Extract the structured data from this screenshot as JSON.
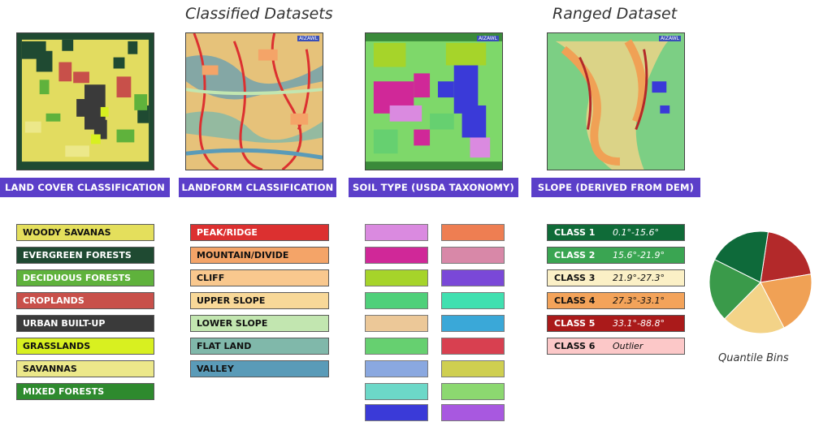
{
  "headings": {
    "classified": "Classified Datasets",
    "ranged": "Ranged Dataset"
  },
  "maps": [
    {
      "label": "LAND COVER CLASSIFICATION",
      "badge": ""
    },
    {
      "label": "LANDFORM CLASSIFICATION",
      "badge": "AIZAWL"
    },
    {
      "label": "SOIL TYPE (USDA TAXONOMY)",
      "badge": "AIZAWL"
    },
    {
      "label": "SLOPE (DERIVED FROM DEM)",
      "badge": "AIZAWL"
    }
  ],
  "land_cover_legend": [
    {
      "label": "WOODY SAVANAS",
      "color": "#e4df5c",
      "text_color": "#111111"
    },
    {
      "label": "EVERGREEN FORESTS",
      "color": "#1f4a32",
      "text_color": "#ffffff"
    },
    {
      "label": "DECIDUOUS FORESTS",
      "color": "#5fb23c",
      "text_color": "#ffffff"
    },
    {
      "label": "CROPLANDS",
      "color": "#c8504a",
      "text_color": "#ffffff"
    },
    {
      "label": "URBAN BUILT-UP",
      "color": "#3a3a3a",
      "text_color": "#ffffff"
    },
    {
      "label": "GRASSLANDS",
      "color": "#d8f020",
      "text_color": "#111111"
    },
    {
      "label": "SAVANNAS",
      "color": "#ece88a",
      "text_color": "#111111"
    },
    {
      "label": "MIXED FORESTS",
      "color": "#2e8a2e",
      "text_color": "#ffffff"
    }
  ],
  "landform_legend": [
    {
      "label": "PEAK/RIDGE",
      "color": "#dc3030",
      "text_color": "#ffffff"
    },
    {
      "label": "MOUNTAIN/DIVIDE",
      "color": "#f4a468",
      "text_color": "#111111"
    },
    {
      "label": "CLIFF",
      "color": "#f9c88e",
      "text_color": "#111111"
    },
    {
      "label": "UPPER SLOPE",
      "color": "#f8d898",
      "text_color": "#111111"
    },
    {
      "label": "LOWER SLOPE",
      "color": "#c2e6b0",
      "text_color": "#111111"
    },
    {
      "label": "FLAT LAND",
      "color": "#80b8aa",
      "text_color": "#111111"
    },
    {
      "label": "VALLEY",
      "color": "#5a9bb8",
      "text_color": "#111111"
    }
  ],
  "soil_legend": {
    "column1": [
      "#da8ae0",
      "#d02898",
      "#a6d42a",
      "#4fd07a",
      "#ecc898",
      "#66d070",
      "#8aa8e0",
      "#6cd8c8",
      "#3a3ad8"
    ],
    "column2": [
      "#ee7e52",
      "#d888a8",
      "#7a48d8",
      "#40e0b0",
      "#3aa8d8",
      "#d84050",
      "#cfcf50",
      "#8cd870",
      "#a858e0"
    ]
  },
  "slope_legend": [
    {
      "name": "CLASS 1",
      "range": "0.1°-15.6°",
      "color": "#0f6b38",
      "text_color": "#ffffff"
    },
    {
      "name": "CLASS 2",
      "range": "15.6°-21.9°",
      "color": "#3aa552",
      "text_color": "#ffffff"
    },
    {
      "name": "CLASS 3",
      "range": "21.9°-27.3°",
      "color": "#fbf0c6",
      "text_color": "#111111"
    },
    {
      "name": "CLASS 4",
      "range": "27.3°-33.1°",
      "color": "#f3a35a",
      "text_color": "#111111"
    },
    {
      "name": "CLASS 5",
      "range": "33.1°-88.8°",
      "color": "#aa1a1a",
      "text_color": "#ffffff"
    },
    {
      "name": "CLASS 6",
      "range": "Outlier",
      "color": "#fcc8c8",
      "text_color": "#111111"
    }
  ],
  "quantile_bins": {
    "caption": "Quantile Bins",
    "slices": [
      {
        "value": 1,
        "color": "#b3292a"
      },
      {
        "value": 1,
        "color": "#f0a155"
      },
      {
        "value": 1,
        "color": "#f3d388"
      },
      {
        "value": 1,
        "color": "#3a9a4a"
      },
      {
        "value": 1,
        "color": "#0e6a3a"
      }
    ]
  }
}
